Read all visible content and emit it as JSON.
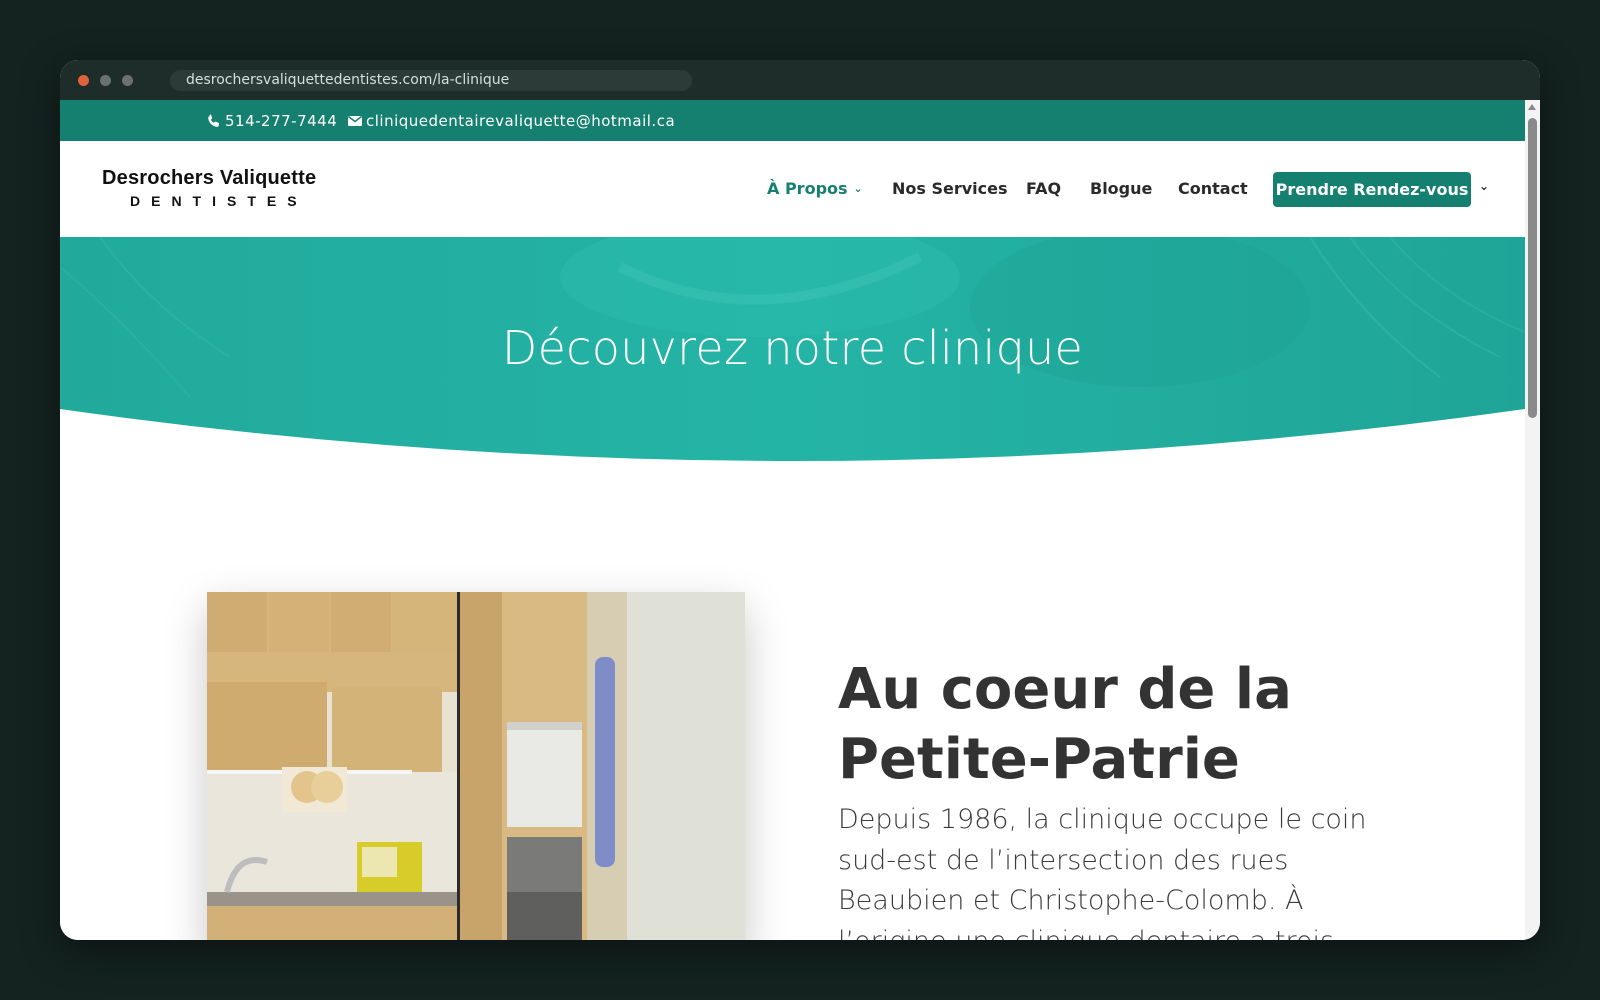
{
  "browser": {
    "url": "desrochersvaliquettedentistes.com/la-clinique"
  },
  "topbar": {
    "phone": "514-277-7444",
    "email": "cliniquedentairevaliquette@hotmail.ca"
  },
  "header": {
    "logo_name": "Desrochers Valiquette",
    "logo_sub": "DENTISTES",
    "nav": [
      {
        "label": "À Propos",
        "active": true,
        "has_dropdown": true
      },
      {
        "label": "Nos Services"
      },
      {
        "label": "FAQ"
      },
      {
        "label": "Blogue"
      },
      {
        "label": "Contact"
      }
    ],
    "cta_label": "Prendre Rendez-vous"
  },
  "hero": {
    "title": "Découvrez notre clinique"
  },
  "content": {
    "heading": "Au coeur de la Petite-Patrie",
    "text": "Depuis 1986, la clinique occupe le coin sud-est de l’intersection des rues Beaubien et Christophe-Colomb. À l’origine une clinique dentaire a trois salle opératoires, nous avons procédé a un"
  },
  "colors": {
    "brand": "#15806f",
    "hero_teal": "#22b3a5",
    "dark_bg": "#142320"
  },
  "icons": {
    "phone": "phone-icon",
    "mail": "mail-icon",
    "chevron": "chevron-down-icon"
  }
}
